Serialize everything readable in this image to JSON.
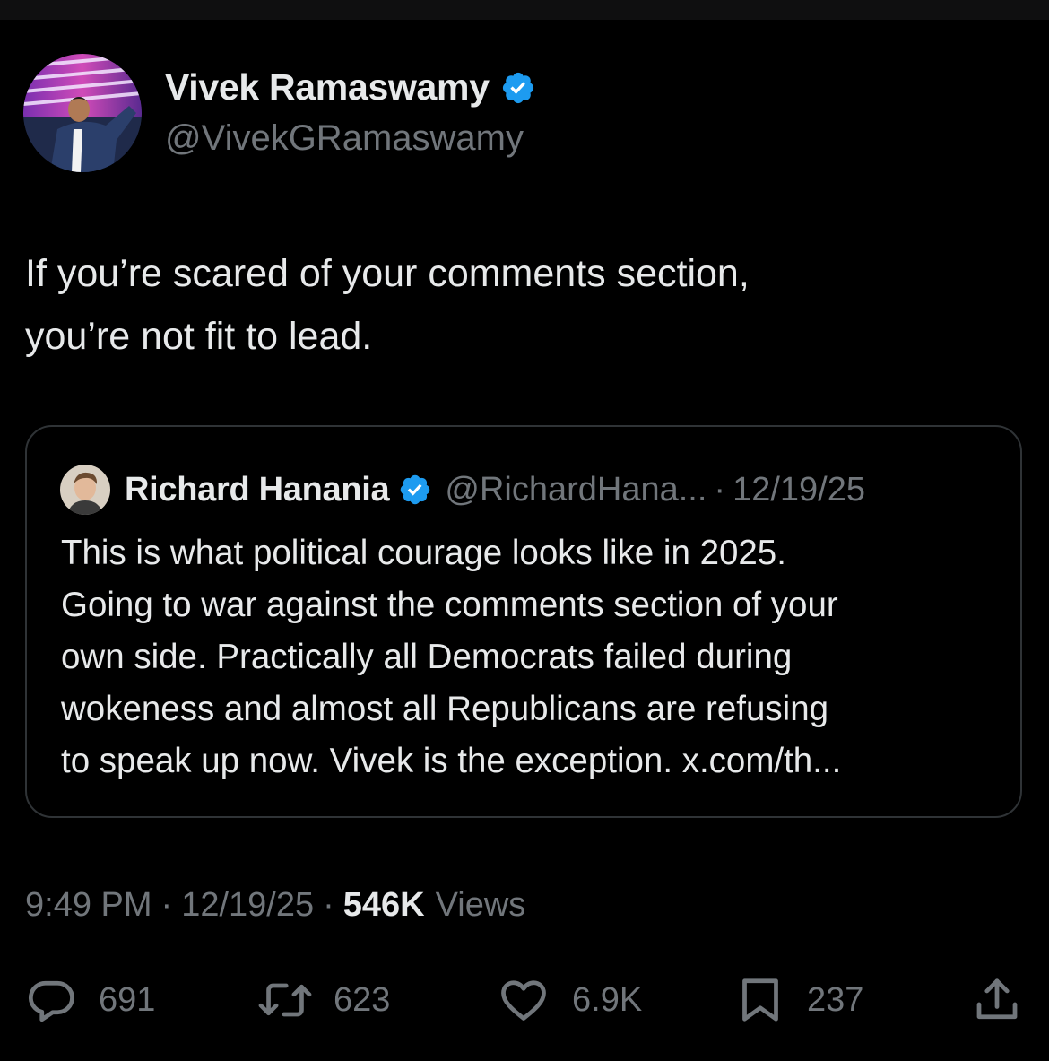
{
  "tweet": {
    "author": {
      "name": "Vivek Ramaswamy",
      "handle": "@VivekGRamaswamy",
      "verified": true
    },
    "text_lines": [
      "If you’re scared of your comments section,",
      "you’re not fit to lead."
    ],
    "quoted": {
      "author_name": "Richard Hanania",
      "handle": "@RichardHana...",
      "separator": "·",
      "date": "12/19/25",
      "verified": true,
      "text_lines": [
        "This is what political courage looks like in 2025.",
        "Going to war against the comments section of your",
        "own side. Practically all Democrats failed during",
        "wokeness and almost all Republicans are refusing",
        "to speak up now. Vivek is the exception. x.com/th..."
      ]
    },
    "meta": {
      "time": "9:49 PM",
      "separator": "·",
      "date": "12/19/25",
      "views_count": "546K",
      "views_label": "Views"
    },
    "actions": {
      "replies": "691",
      "reposts": "623",
      "likes": "6.9K",
      "bookmarks": "237"
    }
  },
  "icons": {
    "verified": "verified-badge-icon",
    "reply": "reply-icon",
    "repost": "repost-icon",
    "like": "heart-icon",
    "bookmark": "bookmark-icon",
    "share": "share-icon"
  },
  "colors": {
    "background": "#000000",
    "text_primary": "#e7e9ea",
    "text_secondary": "#71767b",
    "border": "#2f3336",
    "verified_blue": "#1d9bf0"
  }
}
